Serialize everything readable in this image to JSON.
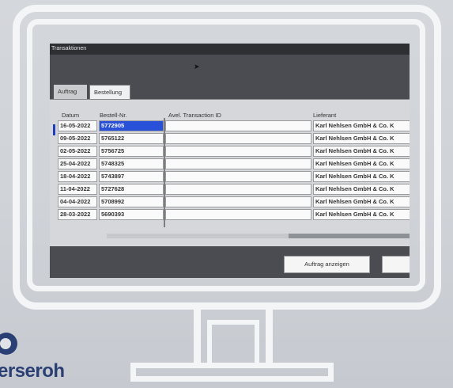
{
  "app": {
    "window_title": "Transaktionen",
    "tabs": [
      {
        "label": "Auftrag"
      },
      {
        "label": "Bestellung"
      }
    ]
  },
  "table": {
    "columns": [
      "Datum",
      "Bestell-Nr.",
      "Avel. Transaction ID",
      "Lieferant"
    ],
    "rows": [
      {
        "datum": "16-05-2022",
        "bestell_nr": "5772905",
        "transaction_id": "",
        "lieferant": "Karl Nehlsen GmbH & Co. K"
      },
      {
        "datum": "09-05-2022",
        "bestell_nr": "5765122",
        "transaction_id": "",
        "lieferant": "Karl Nehlsen GmbH & Co. K"
      },
      {
        "datum": "02-05-2022",
        "bestell_nr": "5756725",
        "transaction_id": "",
        "lieferant": "Karl Nehlsen GmbH & Co. K"
      },
      {
        "datum": "25-04-2022",
        "bestell_nr": "5748325",
        "transaction_id": "",
        "lieferant": "Karl Nehlsen GmbH & Co. K"
      },
      {
        "datum": "18-04-2022",
        "bestell_nr": "5743897",
        "transaction_id": "",
        "lieferant": "Karl Nehlsen GmbH & Co. K"
      },
      {
        "datum": "11-04-2022",
        "bestell_nr": "5727628",
        "transaction_id": "",
        "lieferant": "Karl Nehlsen GmbH & Co. K"
      },
      {
        "datum": "04-04-2022",
        "bestell_nr": "5708992",
        "transaction_id": "",
        "lieferant": "Karl Nehlsen GmbH & Co. K"
      },
      {
        "datum": "28-03-2022",
        "bestell_nr": "5690393",
        "transaction_id": "",
        "lieferant": "Karl Nehlsen GmbH & Co. K"
      }
    ]
  },
  "buttons": {
    "show_order": "Auftrag anzeigen",
    "second": ""
  },
  "logo": {
    "text": "erseroh"
  },
  "colors": {
    "selection": "#2950d9",
    "logo": "#2a3f73"
  }
}
